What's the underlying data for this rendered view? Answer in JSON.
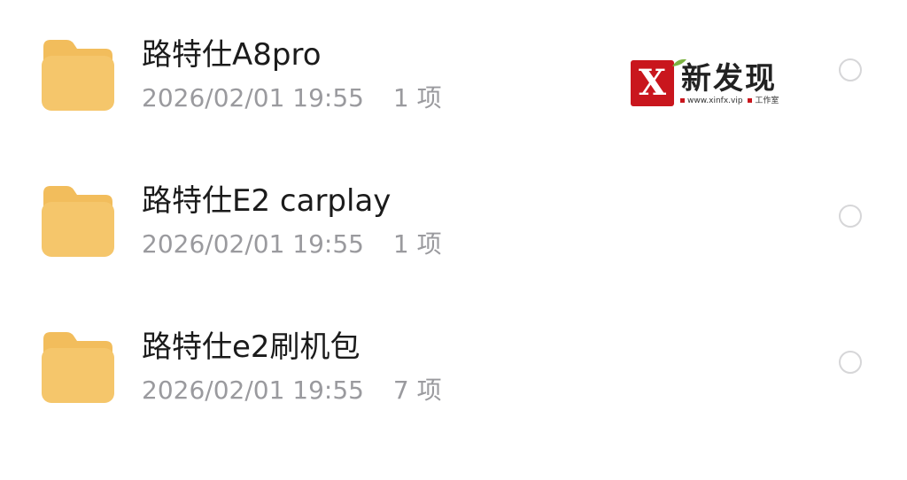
{
  "files": [
    {
      "name": "路特仕A8pro",
      "date": "2026/02/01 19:55",
      "count": "1 项",
      "icon": "folder-icon",
      "selected": false
    },
    {
      "name": "路特仕E2 carplay",
      "date": "2026/02/01 19:55",
      "count": "1 项",
      "icon": "folder-icon",
      "selected": false
    },
    {
      "name": "路特仕e2刷机包",
      "date": "2026/02/01 19:55",
      "count": "7 项",
      "icon": "folder-icon",
      "selected": false
    }
  ],
  "watermark": {
    "mark": "X",
    "title": "新发现",
    "url": "www.xinfx.vip",
    "tagline": "工作室",
    "brand_color": "#c9161d"
  },
  "colors": {
    "folder": "#f5c66b",
    "folder_tab": "#f2bd5c",
    "name_text": "#1b1b1b",
    "meta_text": "#9a9a9e",
    "radio_border": "#d6d6d8"
  }
}
